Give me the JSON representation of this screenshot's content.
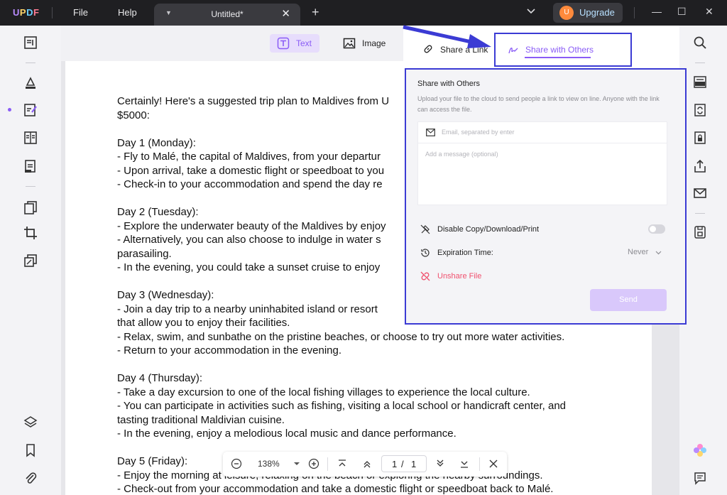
{
  "titlebar": {
    "logo": [
      "U",
      "P",
      "D",
      "F"
    ],
    "menu_file": "File",
    "menu_help": "Help",
    "tab_title": "Untitled*",
    "tab_close": "✕",
    "new_tab": "+",
    "upgrade_label": "Upgrade",
    "avatar_initial": "U",
    "window_controls": [
      "—",
      "☐",
      "✕"
    ]
  },
  "toolbar": {
    "text_label": "Text",
    "image_label": "Image"
  },
  "share_tabs": {
    "link_label": "Share a Link",
    "others_label": "Share with Others"
  },
  "share_panel": {
    "title": "Share with Others",
    "description": "Upload your file to the cloud to send people a link to view on line. Anyone with the link can access the file.",
    "email_placeholder": "Email, separated by enter",
    "message_placeholder": "Add a message (optional)",
    "disable_label": "Disable Copy/Download/Print",
    "expiration_label": "Expiration Time:",
    "expiration_value": "Never",
    "unshare_label": "Unshare File",
    "send_label": "Send"
  },
  "document": {
    "text": "Certainly! Here's a suggested trip plan to Maldives from U\n$5000:\n\nDay 1 (Monday):\n- Fly to Malé, the capital of Maldives, from your departur\n- Upon arrival, take a domestic flight or speedboat to you\n- Check-in to your accommodation and spend the day re\n\nDay 2 (Tuesday):\n- Explore the underwater beauty of the Maldives by enjoy\n- Alternatively, you can also choose to indulge in water s\nparasailing.\n- In the evening, you could take a sunset cruise to enjoy\n\nDay 3 (Wednesday):\n- Join a day trip to a nearby uninhabited island or resort\nthat allow you to enjoy their facilities.\n- Relax, swim, and sunbathe on the pristine beaches, or choose to try out more water activities.\n- Return to your accommodation in the evening.\n\nDay 4 (Thursday):\n- Take a day excursion to one of the local fishing villages to experience the local culture.\n- You can participate in activities such as fishing, visiting a local school or handicraft center, and\ntasting traditional Maldivian cuisine.\n- In the evening, enjoy a melodious local music and dance performance.\n\nDay 5 (Friday):\n- Enjoy the morning at leisure, relaxing on the beach or exploring the nearby surroundings.\n- Check-out from your accommodation and take a domestic flight or speedboat back to Malé."
  },
  "pagenav": {
    "zoom": "138%",
    "current_page": "1",
    "page_separator": "/",
    "total_pages": "1"
  },
  "colors": {
    "accent": "#8a5cf6",
    "highlight_border": "#3b3bd4",
    "danger": "#f0506e"
  }
}
